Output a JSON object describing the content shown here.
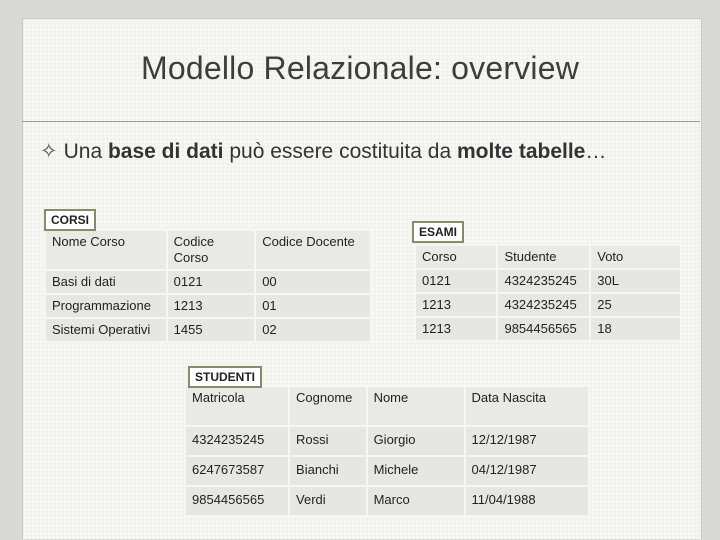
{
  "slide": {
    "title": "Modello Relazionale: overview",
    "bullet": {
      "t1": "Una ",
      "b1": "base di dati",
      "t2": " può essere costituita da ",
      "b2": "molte tabelle",
      "t3": "…"
    }
  },
  "corsi": {
    "label": "CORSI",
    "headers": [
      "Nome Corso",
      "Codice Corso",
      "Codice Docente"
    ],
    "rows": [
      [
        "Basi di dati",
        "0121",
        "00"
      ],
      [
        "Programmazione",
        "1213",
        "01"
      ],
      [
        "Sistemi Operativi",
        "1455",
        "02"
      ]
    ]
  },
  "esami": {
    "label": "ESAMI",
    "headers": [
      "Corso",
      "Studente",
      "Voto"
    ],
    "rows": [
      [
        "0121",
        "4324235245",
        "30L"
      ],
      [
        "1213",
        "4324235245",
        "25"
      ],
      [
        "1213",
        "9854456565",
        "18"
      ]
    ]
  },
  "studenti": {
    "label": "STUDENTI",
    "headers": [
      "Matricola",
      "Cognome",
      "Nome",
      "Data Nascita"
    ],
    "rows": [
      [
        "4324235245",
        "Rossi",
        "Giorgio",
        "12/12/1987"
      ],
      [
        "6247673587",
        "Bianchi",
        "Michele",
        "04/12/1987"
      ],
      [
        "9854456565",
        "Verdi",
        "Marco",
        "11/04/1988"
      ]
    ]
  }
}
